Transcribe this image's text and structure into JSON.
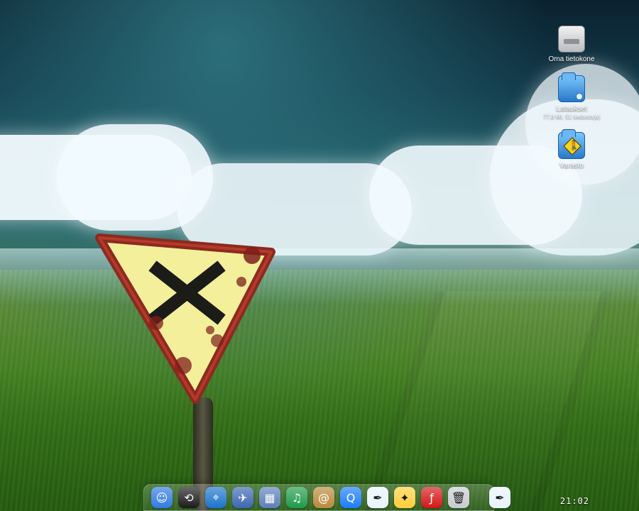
{
  "desktop": {
    "icons": [
      {
        "name": "Oma tietokone",
        "sub": ""
      },
      {
        "name": "Lataukset",
        "sub": "77,8 Mt, 51 tiedosto(a)"
      },
      {
        "name": "Varasto",
        "sub": ""
      }
    ]
  },
  "dock": {
    "items": [
      {
        "name": "finder-icon",
        "glyph": "☺",
        "bg": "#2f7ae0"
      },
      {
        "name": "dashboard-icon",
        "glyph": "⟲",
        "bg": "#1b1b1b"
      },
      {
        "name": "safari-icon",
        "glyph": "⌖",
        "bg": "#1c74c9"
      },
      {
        "name": "mail-stamp-icon",
        "glyph": "✈",
        "bg": "#3b67b0"
      },
      {
        "name": "photos-icon",
        "glyph": "▦",
        "bg": "#5b7fb8"
      },
      {
        "name": "music-icon",
        "glyph": "♫",
        "bg": "#1e9a4a"
      },
      {
        "name": "address-book-icon",
        "glyph": "@",
        "bg": "#b8893b"
      },
      {
        "name": "quicktime-icon",
        "glyph": "Q",
        "bg": "#1a7cff"
      },
      {
        "name": "feather-app-icon",
        "glyph": "✒",
        "bg": "#e8f4ff"
      },
      {
        "name": "illustrator-style-icon",
        "glyph": "✦",
        "bg": "#ffcf3a"
      },
      {
        "name": "flash-icon",
        "glyph": "ƒ",
        "bg": "#d41616"
      },
      {
        "name": "trash-icon",
        "glyph": "🗑",
        "bg": "#c9cbd0"
      },
      {
        "name": "feather-app-icon-2",
        "glyph": "✒",
        "bg": "#e8f4ff"
      }
    ]
  },
  "clock": {
    "time": "21:02"
  }
}
